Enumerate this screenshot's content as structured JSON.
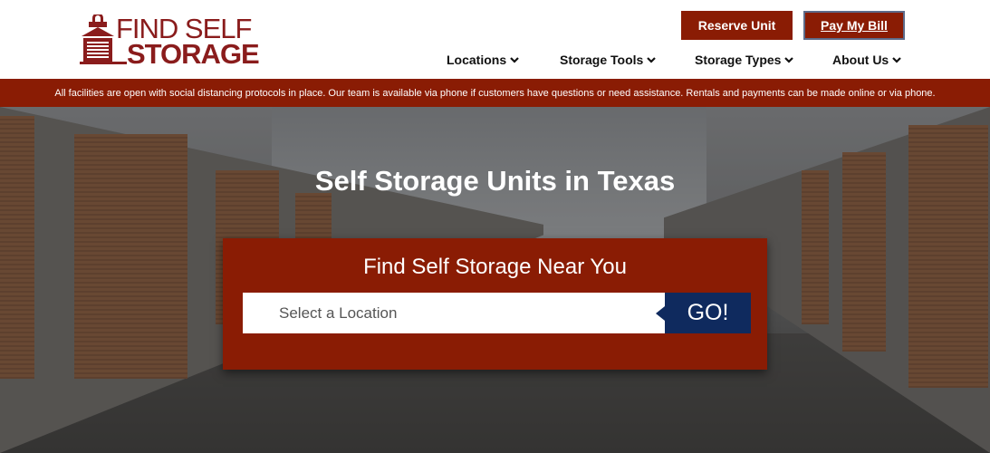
{
  "logo": {
    "line1": "FIND SELF",
    "line2": "STORAGE"
  },
  "header": {
    "reserve_label": "Reserve Unit",
    "pay_label": "Pay My Bill"
  },
  "nav": {
    "items": [
      {
        "label": "Locations"
      },
      {
        "label": "Storage Tools"
      },
      {
        "label": "Storage Types"
      },
      {
        "label": "About Us"
      }
    ]
  },
  "notice": {
    "text": "All facilities are open with social distancing protocols in place. Our team is available via phone if customers have questions or need assistance. Rentals and payments can be made online or via phone."
  },
  "hero": {
    "title": "Self Storage Units in Texas",
    "search_title": "Find Self Storage Near You",
    "search_placeholder": "Select a Location",
    "go_label": "GO!"
  },
  "colors": {
    "brand": "#8a1c04",
    "navy": "#0f2a5e"
  },
  "icons": {
    "nav_dropdown": "chevron-down-icon",
    "logo_mark": "storage-building-icon"
  }
}
